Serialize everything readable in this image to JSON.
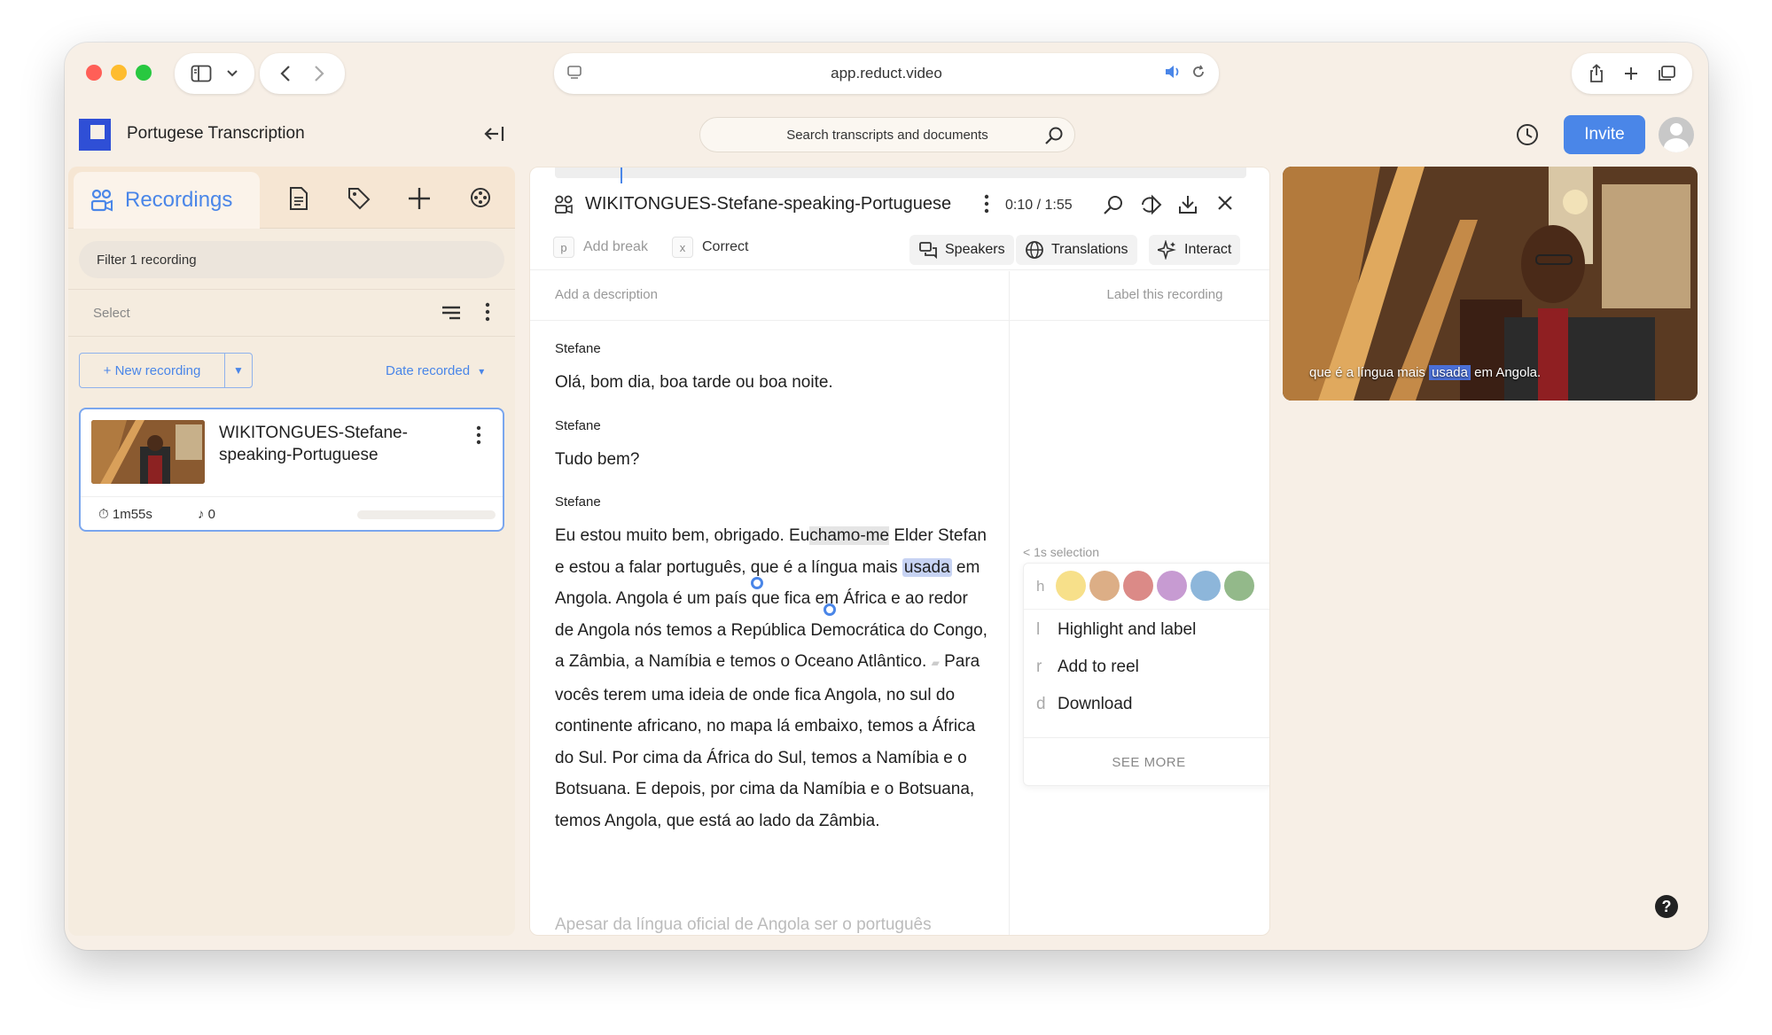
{
  "browser": {
    "url": "app.reduct.video"
  },
  "header": {
    "project_title": "Portugese Transcription",
    "search_placeholder": "Search transcripts and documents",
    "invite_label": "Invite"
  },
  "left_panel": {
    "active_tab": "Recordings",
    "filter_placeholder": "Filter 1 recording",
    "select_label": "Select",
    "new_recording_label": "+ New recording",
    "sort_label": "Date recorded",
    "recording": {
      "title": "WIKITONGUES-Stefane-speaking-Portuguese",
      "duration": "1m55s",
      "clips": "0"
    }
  },
  "document": {
    "title": "WIKITONGUES-Stefane-speaking-Portuguese",
    "time": "0:10 / 1:55",
    "toolbar": {
      "add_break_key": "p",
      "add_break_label": "Add break",
      "correct_key": "x",
      "correct_label": "Correct",
      "speakers_label": "Speakers",
      "translations_label": "Translations",
      "interact_label": "Interact"
    },
    "description_placeholder": "Add a description",
    "label_placeholder": "Label this recording",
    "paragraphs": [
      {
        "speaker": "Stefane",
        "text": "Olá, bom dia, boa tarde ou boa noite."
      },
      {
        "speaker": "Stefane",
        "text": "Tudo bem?"
      },
      {
        "speaker": "Stefane",
        "text_a": "Eu estou muito bem, obrigado. Eu",
        "text_sel": "chamo-me",
        "text_b": " Elder Stefan e estou a falar português, que é a língua mais ",
        "text_hl": "usada",
        "text_c": " em Angola. Angola é um país que fica em África e ao redor de Angola nós temos a República Democrática do Congo, a Zâmbia, a Namíbia e temos o Oceano Atlântico. ",
        "text_d": " Para vocês terem uma ideia de onde fica Angola, no sul do continente africano, no mapa lá embaixo, temos a África do Sul. Por cima da África do Sul, temos a Namíbia e o Botsuana. E depois, por cima da Namíbia e o Botsuana, temos Angola, que está ao lado da Zâmbia."
      }
    ],
    "next_paragraph_fragment": "Apesar da língua oficial de Angola ser o português"
  },
  "selection_menu": {
    "hint": "< 1s selection",
    "color_key": "h",
    "colors": [
      "#f7e08a",
      "#dcae86",
      "#db8a87",
      "#c79bd2",
      "#8db6da",
      "#93b98a"
    ],
    "items": [
      {
        "key": "l",
        "label": "Highlight and label"
      },
      {
        "key": "r",
        "label": "Add to reel"
      },
      {
        "key": "d",
        "label": "Download"
      }
    ],
    "see_more": "SEE MORE"
  },
  "video": {
    "caption_a": "que é a língua mais ",
    "caption_hl": "usada",
    "caption_b": " em Angola."
  },
  "help_label": "?"
}
